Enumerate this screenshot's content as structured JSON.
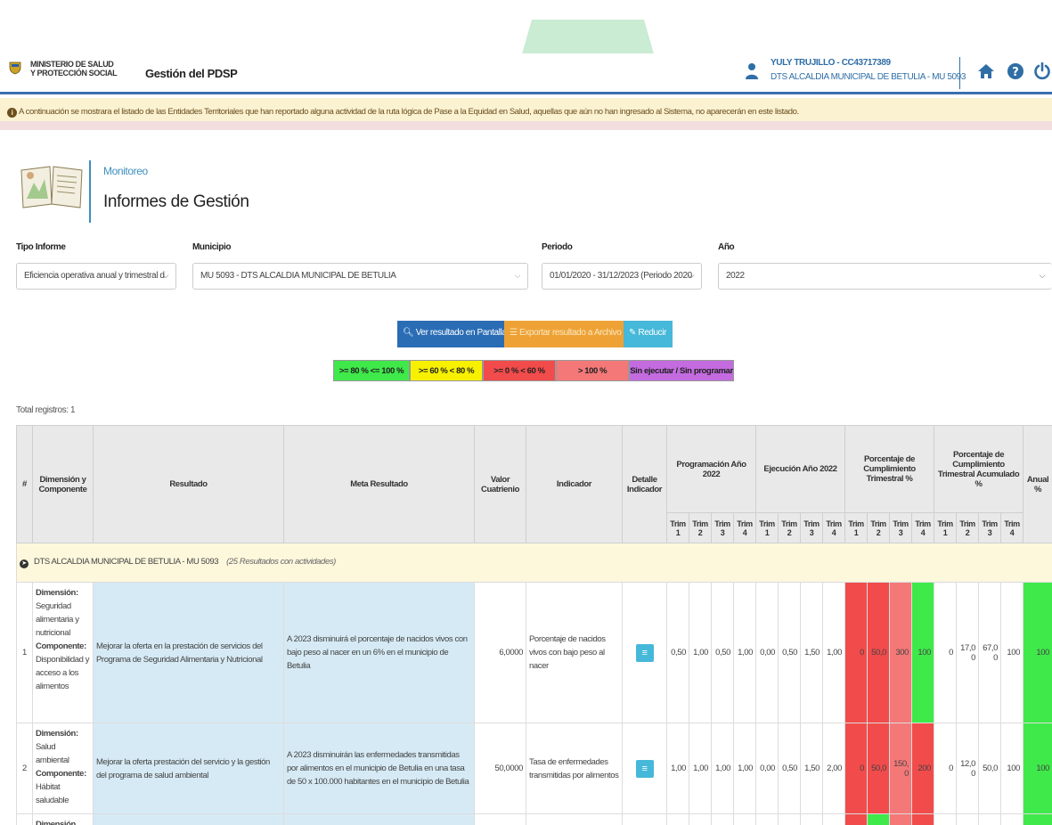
{
  "header": {
    "ministry": [
      "MINISTERIO DE SALUD",
      "Y PROTECCIÓN SOCIAL"
    ],
    "app_title": "Gestión del PDSP",
    "user_name": "YULY TRUJILLO - CC43717389",
    "user_entity": "DTS ALCALDIA MUNICIPAL DE BETULIA - MU 5093",
    "icons": [
      "user-icon",
      "home-icon",
      "help-icon",
      "power-icon"
    ]
  },
  "notice": "A continuación se mostrara el listado de las Entidades Territoriales que han reportado alguna actividad de la ruta lógica de Pase a la Equidad en Salud, aquellas que aún no han ingresado al Sistema, no aparecerán en este listado.",
  "page": {
    "breadcrumb": "Monitoreo",
    "title": "Informes de Gestión"
  },
  "filters": {
    "tipo_label": "Tipo Informe",
    "tipo_value": "Eficiencia operativa anual y trimestral d",
    "municipio_label": "Municipio",
    "municipio_value": "MU 5093 - DTS ALCALDIA MUNICIPAL DE BETULIA",
    "periodo_label": "Periodo",
    "periodo_value": "01/01/2020 - 31/12/2023 (Periodo 2020",
    "anio_label": "Año",
    "anio_value": "2022"
  },
  "actions": {
    "ver": "Ver resultado en Pantalla",
    "exportar": "Exportar resultado a Archivo",
    "reducir": "Reducir"
  },
  "legend": [
    {
      "label": ">= 80 % <= 100 %",
      "color": "#3fe94a"
    },
    {
      "label": ">= 60 % < 80 %",
      "color": "#f7f000"
    },
    {
      "label": ">= 0 % < 60 %",
      "color": "#f24b4b"
    },
    {
      "label": "> 100 %",
      "color": "#f57878"
    },
    {
      "label": "Sin ejecutar / Sin programar",
      "color": "#c46be0"
    }
  ],
  "total": "Total registros: 1",
  "table": {
    "headers": {
      "num": "#",
      "dimension": "Dimensión y Componente",
      "resultado": "Resultado",
      "meta": "Meta Resultado",
      "valor": "Valor Cuatrienio",
      "indicador": "Indicador",
      "detalle": "Detalle Indicador",
      "programacion": "Programación Año 2022",
      "ejecucion": "Ejecución Año 2022",
      "pct_trim": "Porcentaje de Cumplimiento Trimestral %",
      "pct_acum": "Porcentaje de Cumplimiento Trimestral Acumulado %",
      "anual": "Anual %",
      "trim": "Trim",
      "trim_nums": [
        "1",
        "2",
        "3",
        "4"
      ]
    },
    "group": {
      "label": "DTS ALCALDIA MUNICIPAL DE BETULIA - MU 5093",
      "note": "(25 Resultados con actividades)"
    },
    "rows": [
      {
        "num": "1",
        "dim_label": "Dimensión",
        "dim_value": "Seguridad alimentaria y nutricional",
        "comp_label": "Componente",
        "comp_value": "Disponibilidad y acceso a los alimentos",
        "resultado": "Mejorar la oferta en la prestación de servicios del Programa de Seguridad Alimentaria y Nutricional",
        "meta": "A 2023 disminuirá el porcentaje de nacidos vivos con bajo peso al nacer en un 6% en el municipio de Betulia",
        "valor": "6,0000",
        "indicador": "Porcentaje de nacidos vivos con bajo peso al nacer",
        "prog": [
          "0,50",
          "1,00",
          "0,50",
          "1,00"
        ],
        "ejec": [
          "0,00",
          "0,50",
          "1,50",
          "1,00"
        ],
        "pct": [
          "0",
          "50,0",
          "300",
          "100"
        ],
        "acum": [
          "0",
          "17,0 0",
          "67,0 0",
          "100"
        ],
        "anual": "100"
      },
      {
        "num": "2",
        "dim_label": "Dimensión",
        "dim_value": "Salud ambiental",
        "comp_label": "Componente",
        "comp_value": "Hábitat saludable",
        "resultado": "Mejorar la oferta prestación del servicio y la gestión del programa de salud ambiental",
        "meta": "A 2023 disminuirán las enfermedades transmitidas por alimentos en el municipio de Betulia en una tasa de 50 x 100.000 habitantes en el municipio de Betulia",
        "valor": "50,0000",
        "indicador": "Tasa de enfermedades transmitidas por alimentos",
        "prog": [
          "1,00",
          "1,00",
          "1,00",
          "1,00"
        ],
        "ejec": [
          "0,00",
          "0,50",
          "1,50",
          "2,00"
        ],
        "pct": [
          "0",
          "50,0",
          "150, 0",
          "200"
        ],
        "acum": [
          "0",
          "12,0 0",
          "50,0",
          "100"
        ],
        "anual": "100"
      },
      {
        "num": "",
        "dim_label": "Dimensión",
        "dim_value": "",
        "comp_label": "",
        "comp_value": "",
        "resultado": "",
        "meta": "",
        "valor": "",
        "indicador": "",
        "prog": [
          "",
          "",
          "",
          ""
        ],
        "ejec": [
          "",
          "",
          "",
          ""
        ],
        "pct": [
          "",
          "",
          "",
          ""
        ],
        "acum": [
          "",
          "",
          "",
          ""
        ],
        "anual": ""
      }
    ]
  }
}
